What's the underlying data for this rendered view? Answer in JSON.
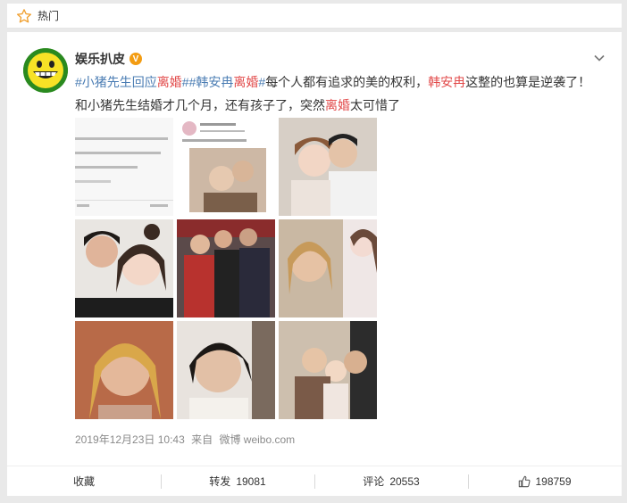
{
  "header": {
    "label": "热门",
    "icon": "star-outline-icon"
  },
  "post": {
    "author": "娱乐扒皮",
    "verified_badge": "V",
    "content": {
      "tag1": "#小猪先生回应",
      "tag1_hl": "离婚",
      "tag1_end": "#",
      "tag2": "#韩安冉",
      "tag2_hl": "离婚",
      "tag2_end": "#",
      "text1": "每个人都有追求的美的权利，",
      "name1": "韩安冉",
      "text2": "这整的也算是逆袭了！",
      "line2a": "和小猪先生结婚才几个月，还有孩子了，突然",
      "line2hl": "离婚",
      "line2b": "太可惜了"
    },
    "timestamp": "2019年12月23日 10:43",
    "source_prefix": "来自",
    "source": "微博 weibo.com",
    "image_count": 9
  },
  "actions": {
    "favorite": "收藏",
    "repost_label": "转发",
    "repost_count": "19081",
    "comment_label": "评论",
    "comment_count": "20553",
    "like_count": "198759"
  },
  "colors": {
    "link": "#4a7cb3",
    "highlight": "#e24a4a",
    "badge": "#f39c12"
  }
}
